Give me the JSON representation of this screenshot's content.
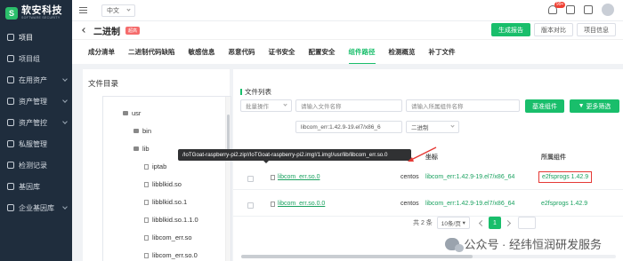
{
  "sidebar": {
    "logo_mark": "S",
    "logo_title": "软安科技",
    "logo_sub": "SOFTWARE SECURITY",
    "items": [
      {
        "label": "项目",
        "icon": "project-icon",
        "active": true,
        "has_children": false
      },
      {
        "label": "项目组",
        "icon": "project-group-icon",
        "active": false,
        "has_children": false
      },
      {
        "label": "在用资产",
        "icon": "asset-icon",
        "active": false,
        "has_children": true
      },
      {
        "label": "资产管理",
        "icon": "asset-manage-icon",
        "active": false,
        "has_children": true
      },
      {
        "label": "资产管控",
        "icon": "asset-control-icon",
        "active": false,
        "has_children": true
      },
      {
        "label": "私服管理",
        "icon": "private-server-icon",
        "active": false,
        "has_children": false
      },
      {
        "label": "检测记录",
        "icon": "record-icon",
        "active": false,
        "has_children": false
      },
      {
        "label": "基因库",
        "icon": "gene-library-icon",
        "active": false,
        "has_children": false
      },
      {
        "label": "企业基因库",
        "icon": "enterprise-gene-icon",
        "active": false,
        "has_children": true
      }
    ]
  },
  "topbar": {
    "language": "中文",
    "notification_count": "99+"
  },
  "header": {
    "title": "二进制",
    "tag": "超高",
    "buttons": {
      "report": "生成报告",
      "compare": "版本对比",
      "info": "项目信息"
    }
  },
  "tabs": [
    "成分清单",
    "二进制代码缺陷",
    "敏感信息",
    "恶意代码",
    "证书安全",
    "配置安全",
    "组件路径",
    "检测概览",
    "补丁文件"
  ],
  "active_tab": "组件路径",
  "file_tree": {
    "title": "文件目录",
    "items": [
      {
        "label": "usr",
        "type": "folder"
      },
      {
        "label": "bin",
        "type": "folder"
      },
      {
        "label": "lib",
        "type": "folder"
      },
      {
        "label": "iptab",
        "type": "file"
      },
      {
        "label": "libblkid.so",
        "type": "file"
      },
      {
        "label": "libblkid.so.1",
        "type": "file"
      },
      {
        "label": "libblkid.so.1.1.0",
        "type": "file"
      },
      {
        "label": "libcom_err.so",
        "type": "file"
      },
      {
        "label": "libcom_err.so.0",
        "type": "file"
      }
    ]
  },
  "file_list": {
    "title": "文件列表",
    "bulk_action": "批量操作",
    "file_name_placeholder": "请输入文件名称",
    "component_placeholder": "请输入所属组件名称",
    "filter_value": "libcom_err:1.42.9-19.el7/x86_6",
    "type_value": "二进制",
    "base_component_button": "基准组件",
    "more_filter_button": "更多筛选",
    "columns": {
      "coord": "坐标",
      "component": "所属组件"
    },
    "rows": [
      {
        "file": "libcom_err.so.0",
        "os": "centos",
        "coord": "libcom_err:1.42.9-19.el7/x86_64",
        "component": "e2fsprogs 1.42.9",
        "highlighted": true
      },
      {
        "file": "libcom_err.so.0.0",
        "os": "centos",
        "coord": "libcom_err:1.42.9-19.el7/x86_64",
        "component": "e2fsprogs 1.42.9",
        "highlighted": false
      }
    ],
    "tooltip": "/IoTGoat-raspberry-pi2.zip!/IoTGoat-raspberry-pi2.img!/1.img!/usr/lib/libcom_err.so.0"
  },
  "pagination": {
    "total": "共 2 条",
    "page_size": "10条/页",
    "current_page": "1"
  },
  "watermark": "公众号 · 经纬恒润研发服务",
  "colors": {
    "accent": "#19be6b",
    "sidebar_bg": "#1f2d3d",
    "highlight_border": "#e53935"
  }
}
